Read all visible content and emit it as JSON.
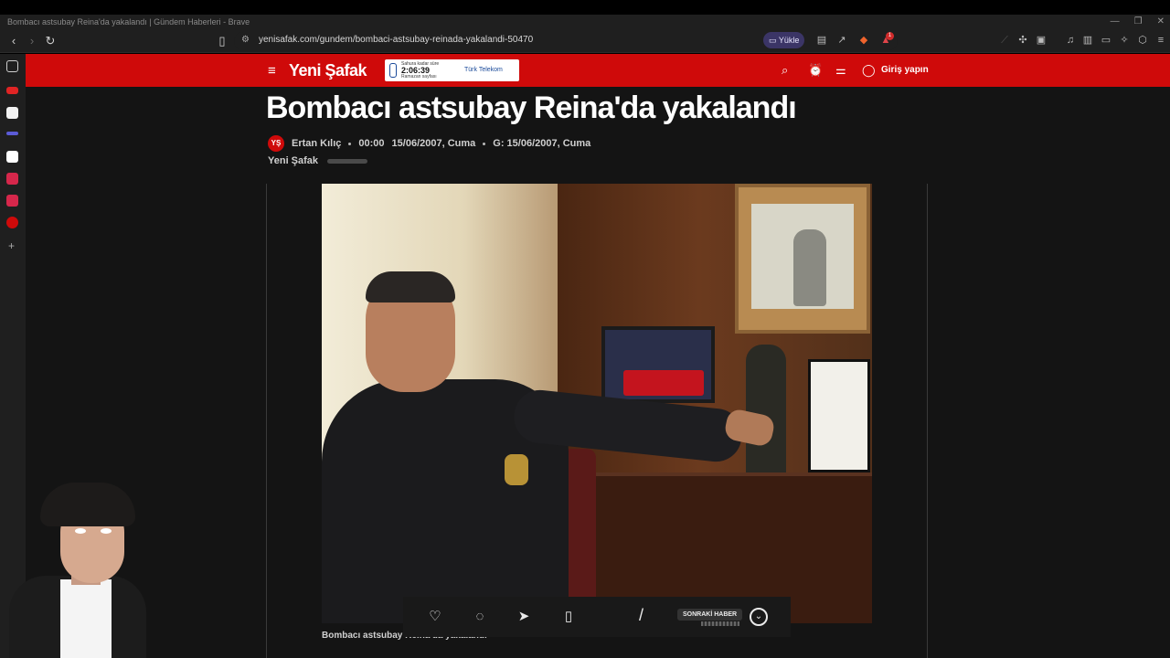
{
  "window": {
    "title": "Bombacı astsubay Reina'da yakalandı | Gündem Haberleri - Brave",
    "controls": [
      "—",
      "❐",
      "✕"
    ]
  },
  "toolbar": {
    "url": "yenisafak.com/gundem/bombaci-astsubay-reinada-yakalandi-50470",
    "upload_label": "Yükle",
    "notification_count": "1"
  },
  "site": {
    "logo": "Yeni Şafak",
    "ad": {
      "line1": "Sahura kadar süre",
      "time": "2:06:39",
      "line2": "Ramazan sayfası",
      "brand": "Türk Telekom"
    },
    "login_label": "Giriş yapın"
  },
  "article": {
    "title": "Bombacı astsubay Reina'da yakalandı",
    "author": "Ertan Kılıç",
    "time": "00:00",
    "date": "15/06/2007, Cuma",
    "updated": "G: 15/06/2007, Cuma",
    "source": "Yeni Şafak",
    "caption": "Bombacı astsubay Reina'da yakalandı"
  },
  "actionbar": {
    "next_label": "SONRAKİ HABER"
  },
  "colors": {
    "brand_red": "#cf0a0a",
    "page_bg": "#141414",
    "chrome_bg": "#1f1f1f"
  },
  "icons": {
    "sidebar": [
      "sidebar-panel-icon",
      "youtube-icon",
      "app-a-icon",
      "app-bar-icon",
      "app-h-icon",
      "app-square-icon",
      "app-square-icon",
      "app-ys-icon",
      "add-icon"
    ]
  }
}
